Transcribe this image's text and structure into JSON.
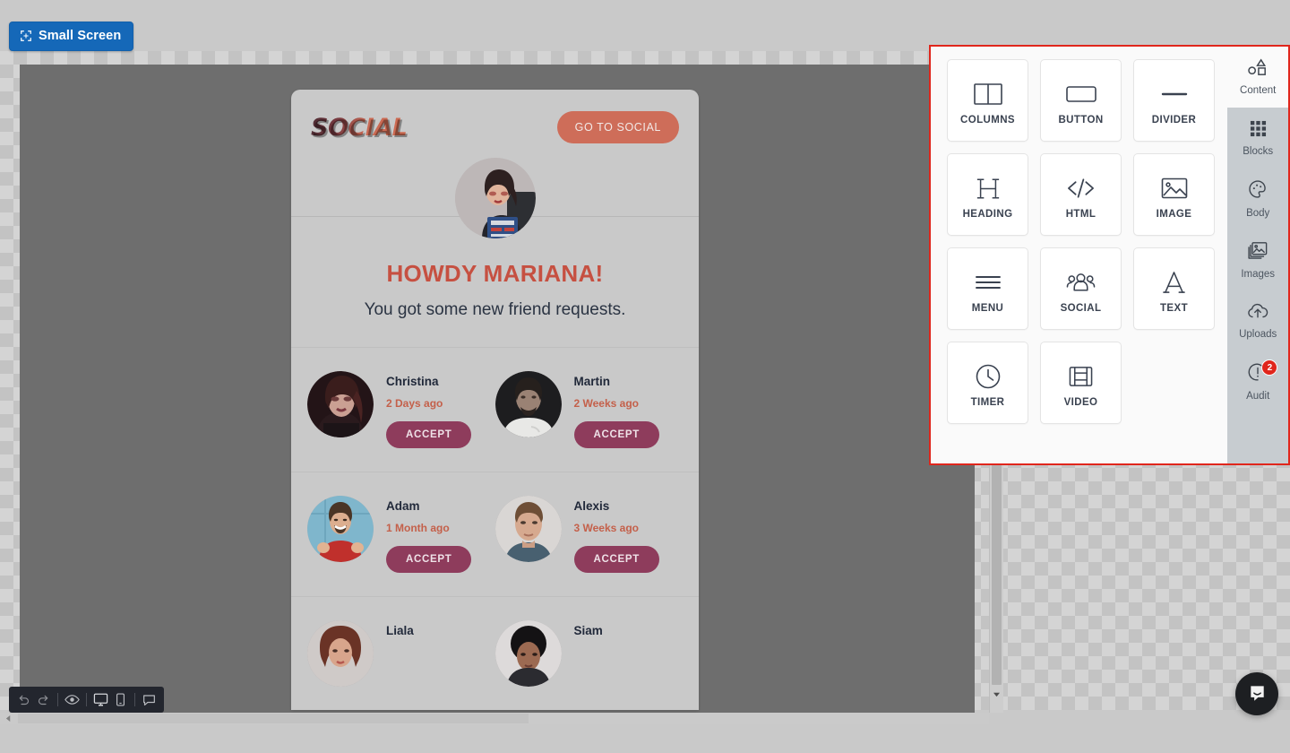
{
  "topbar": {
    "small_screen_label": "Small Screen",
    "small_screen_icon": "resize-icon",
    "button_color": "#1568b8"
  },
  "email": {
    "logo": "SOCIAL",
    "cta_label": "GO TO SOCIAL",
    "cta_color": "#ce6d59",
    "headline": "HOWDY MARIANA!",
    "headline_color": "#c65041",
    "subline": "You got some new friend requests.",
    "accept_label": "ACCEPT",
    "accept_color": "#8e3c5c",
    "requests": [
      [
        {
          "name": "Christina",
          "time": "2 Days ago",
          "action": "ACCEPT"
        },
        {
          "name": "Martin",
          "time": "2 Weeks ago",
          "action": "ACCEPT"
        }
      ],
      [
        {
          "name": "Adam",
          "time": "1 Month ago",
          "action": "ACCEPT"
        },
        {
          "name": "Alexis",
          "time": "3 Weeks ago",
          "action": "ACCEPT"
        }
      ],
      [
        {
          "name": "Liala",
          "time": "",
          "action": ""
        },
        {
          "name": "Siam",
          "time": "",
          "action": ""
        }
      ]
    ]
  },
  "bottom_toolbar": {
    "items": [
      {
        "name": "undo",
        "icon": "undo-icon"
      },
      {
        "name": "redo",
        "icon": "redo-icon"
      },
      {
        "name": "preview",
        "icon": "eye-icon"
      },
      {
        "name": "desktop",
        "icon": "desktop-icon"
      },
      {
        "name": "mobile",
        "icon": "mobile-icon"
      },
      {
        "name": "comments",
        "icon": "comment-icon"
      }
    ]
  },
  "panel": {
    "border_color": "#e0261c",
    "blocks": [
      {
        "label": "COLUMNS",
        "icon": "columns-icon"
      },
      {
        "label": "BUTTON",
        "icon": "button-icon"
      },
      {
        "label": "DIVIDER",
        "icon": "divider-icon"
      },
      {
        "label": "HEADING",
        "icon": "heading-icon"
      },
      {
        "label": "HTML",
        "icon": "code-icon"
      },
      {
        "label": "IMAGE",
        "icon": "image-icon"
      },
      {
        "label": "MENU",
        "icon": "menu-icon"
      },
      {
        "label": "SOCIAL",
        "icon": "people-icon"
      },
      {
        "label": "TEXT",
        "icon": "text-icon"
      },
      {
        "label": "TIMER",
        "icon": "clock-icon"
      },
      {
        "label": "VIDEO",
        "icon": "film-icon"
      }
    ],
    "rail": [
      {
        "label": "Content",
        "icon": "shapes-icon",
        "active": true,
        "badge": ""
      },
      {
        "label": "Blocks",
        "icon": "grid-icon",
        "active": false,
        "badge": ""
      },
      {
        "label": "Body",
        "icon": "palette-icon",
        "active": false,
        "badge": ""
      },
      {
        "label": "Images",
        "icon": "images-icon",
        "active": false,
        "badge": ""
      },
      {
        "label": "Uploads",
        "icon": "upload-cloud-icon",
        "active": false,
        "badge": ""
      },
      {
        "label": "Audit",
        "icon": "alert-icon",
        "active": false,
        "badge": "2"
      }
    ]
  },
  "chat": {
    "icon": "chat-bubble-icon"
  }
}
